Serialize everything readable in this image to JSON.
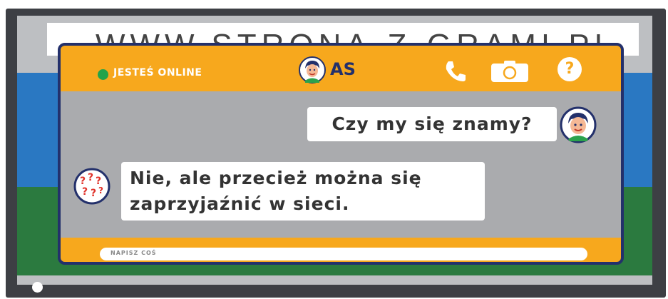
{
  "website": {
    "url_text": "WWW.STRONA-Z-GRAMI.PL"
  },
  "chat": {
    "header": {
      "status_text": "JESTEŚ ONLINE",
      "contact_name": "AS",
      "icons": [
        "phone-icon",
        "camera-icon",
        "help-icon"
      ],
      "help_symbol": "?"
    },
    "messages": [
      {
        "side": "right",
        "avatar": "boy-avatar",
        "text": "Czy my się znamy?"
      },
      {
        "side": "left",
        "avatar": "question-marks-avatar",
        "text_line1": "Nie, ale przecież można się",
        "text_line2": "zaprzyjaźnić w sieci."
      }
    ],
    "input": {
      "placeholder": "NAPISZ COŚ"
    }
  },
  "colors": {
    "accent_orange": "#f7a81d",
    "frame_navy": "#23306b",
    "online_green": "#21a34a",
    "chat_bg_gray": "#aaabae"
  }
}
